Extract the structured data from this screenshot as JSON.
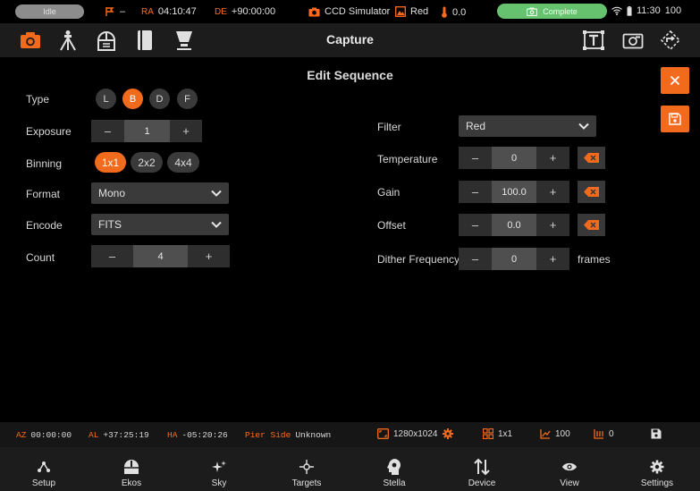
{
  "status": {
    "state": "Idle",
    "tracking": "–",
    "ra_label": "RA",
    "ra_value": "04:10:47",
    "de_label": "DE",
    "de_value": "+90:00:00",
    "camera": "CCD Simulator",
    "filter": "Red",
    "temperature": "0.0",
    "capture_state": "Complete",
    "time": "11:30",
    "battery": "100"
  },
  "toolbar": {
    "title": "Capture"
  },
  "sequence": {
    "heading": "Edit Sequence",
    "type": {
      "label": "Type",
      "options": [
        "L",
        "B",
        "D",
        "F"
      ],
      "selected": "B"
    },
    "exposure": {
      "label": "Exposure",
      "value": "1",
      "minus": "–",
      "plus": "+"
    },
    "binning": {
      "label": "Binning",
      "options": [
        "1x1",
        "2x2",
        "4x4"
      ],
      "selected": "1x1"
    },
    "format": {
      "label": "Format",
      "value": "Mono"
    },
    "encode": {
      "label": "Encode",
      "value": "FITS"
    },
    "count": {
      "label": "Count",
      "value": "4",
      "minus": "–",
      "plus": "+"
    },
    "filter": {
      "label": "Filter",
      "value": "Red"
    },
    "temperature": {
      "label": "Temperature",
      "value": "0",
      "minus": "–",
      "plus": "+"
    },
    "gain": {
      "label": "Gain",
      "value": "100.0",
      "minus": "–",
      "plus": "+"
    },
    "offset": {
      "label": "Offset",
      "value": "0.0",
      "minus": "–",
      "plus": "+"
    },
    "dither": {
      "label": "Dither Frequency",
      "value": "0",
      "minus": "–",
      "plus": "+",
      "unit": "frames"
    }
  },
  "infobar": {
    "az_label": "AZ",
    "az_value": "00:00:00",
    "al_label": "AL",
    "al_value": "+37:25:19",
    "ha_label": "HA",
    "ha_value": "-05:20:26",
    "pier_label": "Pier Side",
    "pier_value": "Unknown",
    "resolution": "1280x1024",
    "binning": "1x1",
    "gain": "100",
    "offset": "0"
  },
  "nav": [
    {
      "label": "Setup",
      "icon": "setup-icon"
    },
    {
      "label": "Ekos",
      "icon": "ekos-icon"
    },
    {
      "label": "Sky",
      "icon": "sky-icon"
    },
    {
      "label": "Targets",
      "icon": "targets-icon"
    },
    {
      "label": "Stella",
      "icon": "stella-icon"
    },
    {
      "label": "Device",
      "icon": "device-icon"
    },
    {
      "label": "View",
      "icon": "eye-icon"
    },
    {
      "label": "Settings",
      "icon": "gear-icon"
    }
  ],
  "colors": {
    "accent": "#f26a1b",
    "complete": "#67c26f",
    "background": "#000000",
    "toolbar": "#1c1c1c"
  }
}
